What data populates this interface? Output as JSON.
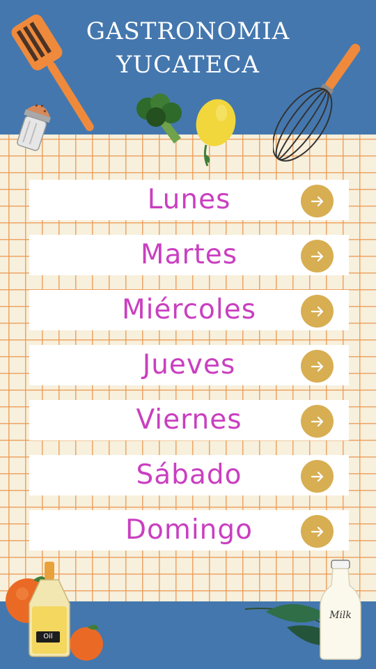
{
  "header": {
    "title_line1": "GASTRONOMIA",
    "title_line2": "YUCATECA"
  },
  "days": [
    {
      "label": "Lunes"
    },
    {
      "label": "Martes"
    },
    {
      "label": "Miércoles"
    },
    {
      "label": "Jueves"
    },
    {
      "label": "Viernes"
    },
    {
      "label": "Sábado"
    },
    {
      "label": "Domingo"
    }
  ],
  "decorations": {
    "oil_bottle_label": "Oil",
    "milk_bottle_label": "Milk"
  },
  "colors": {
    "background_blue": "#4477ae",
    "grid_paper": "#f7f0dc",
    "grid_lines": "#ec9650",
    "day_text": "#c93fc0",
    "arrow_button": "#d7ae52"
  }
}
